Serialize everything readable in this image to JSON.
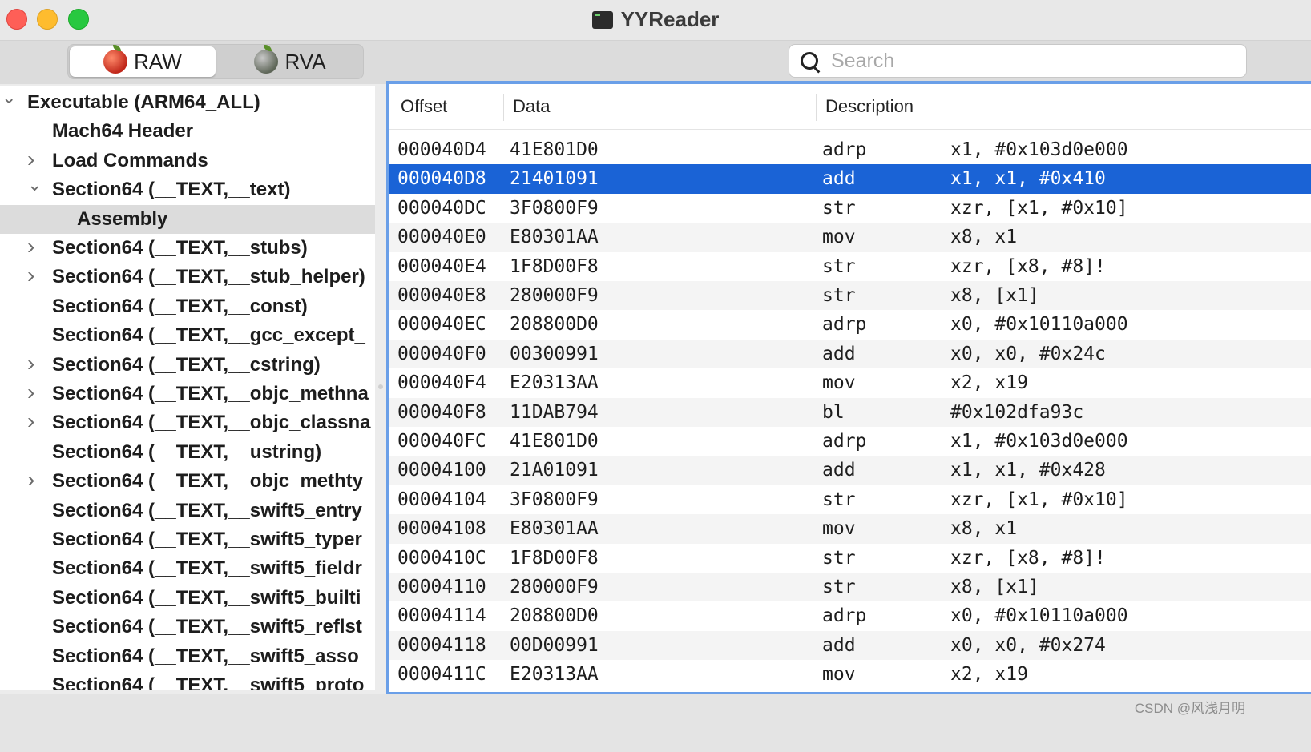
{
  "window": {
    "title": "YYReader"
  },
  "toolbar": {
    "segments": [
      {
        "label": "RAW",
        "icon": "apple-red-icon",
        "active": true
      },
      {
        "label": "RVA",
        "icon": "apple-gray-icon",
        "active": false
      }
    ],
    "search": {
      "placeholder": "Search",
      "value": ""
    }
  },
  "sidebar": {
    "items": [
      {
        "label": "Executable  (ARM64_ALL)",
        "indent": 0,
        "disclosure": "expanded"
      },
      {
        "label": "Mach64 Header",
        "indent": 1,
        "disclosure": "none"
      },
      {
        "label": "Load Commands",
        "indent": 1,
        "disclosure": "collapsed"
      },
      {
        "label": "Section64 (__TEXT,__text)",
        "indent": 1,
        "disclosure": "expanded"
      },
      {
        "label": "Assembly",
        "indent": 2,
        "disclosure": "none",
        "selected": true
      },
      {
        "label": "Section64 (__TEXT,__stubs)",
        "indent": 1,
        "disclosure": "collapsed"
      },
      {
        "label": "Section64 (__TEXT,__stub_helper)",
        "indent": 1,
        "disclosure": "collapsed"
      },
      {
        "label": "Section64 (__TEXT,__const)",
        "indent": 1,
        "disclosure": "none"
      },
      {
        "label": "Section64 (__TEXT,__gcc_except_",
        "indent": 1,
        "disclosure": "none"
      },
      {
        "label": "Section64 (__TEXT,__cstring)",
        "indent": 1,
        "disclosure": "collapsed"
      },
      {
        "label": "Section64 (__TEXT,__objc_methna",
        "indent": 1,
        "disclosure": "collapsed"
      },
      {
        "label": "Section64 (__TEXT,__objc_classna",
        "indent": 1,
        "disclosure": "collapsed"
      },
      {
        "label": "Section64 (__TEXT,__ustring)",
        "indent": 1,
        "disclosure": "none"
      },
      {
        "label": "Section64 (__TEXT,__objc_methty",
        "indent": 1,
        "disclosure": "collapsed"
      },
      {
        "label": "Section64 (__TEXT,__swift5_entry",
        "indent": 1,
        "disclosure": "none"
      },
      {
        "label": "Section64 (__TEXT,__swift5_typer",
        "indent": 1,
        "disclosure": "none"
      },
      {
        "label": "Section64 (__TEXT,__swift5_fieldr",
        "indent": 1,
        "disclosure": "none"
      },
      {
        "label": "Section64 (__TEXT,__swift5_builti",
        "indent": 1,
        "disclosure": "none"
      },
      {
        "label": "Section64 (__TEXT,__swift5_reflst",
        "indent": 1,
        "disclosure": "none"
      },
      {
        "label": "Section64 (__TEXT,__swift5_asso",
        "indent": 1,
        "disclosure": "none"
      },
      {
        "label": "Section64 (__TEXT,__swift5_proto",
        "indent": 1,
        "disclosure": "none"
      }
    ]
  },
  "table": {
    "headers": [
      "Offset",
      "Data",
      "Description"
    ],
    "selected_index": 1,
    "rows": [
      {
        "offset": "000040D4",
        "data": "41E801D0",
        "op": "adrp",
        "args": "x1, #0x103d0e000"
      },
      {
        "offset": "000040D8",
        "data": "21401091",
        "op": "add",
        "args": "x1, x1, #0x410"
      },
      {
        "offset": "000040DC",
        "data": "3F0800F9",
        "op": "str",
        "args": "xzr, [x1, #0x10]"
      },
      {
        "offset": "000040E0",
        "data": "E80301AA",
        "op": "mov",
        "args": "x8, x1"
      },
      {
        "offset": "000040E4",
        "data": "1F8D00F8",
        "op": "str",
        "args": "xzr, [x8, #8]!"
      },
      {
        "offset": "000040E8",
        "data": "280000F9",
        "op": "str",
        "args": "x8, [x1]"
      },
      {
        "offset": "000040EC",
        "data": "208800D0",
        "op": "adrp",
        "args": "x0, #0x10110a000"
      },
      {
        "offset": "000040F0",
        "data": "00300991",
        "op": "add",
        "args": "x0, x0, #0x24c"
      },
      {
        "offset": "000040F4",
        "data": "E20313AA",
        "op": "mov",
        "args": "x2, x19"
      },
      {
        "offset": "000040F8",
        "data": "11DAB794",
        "op": "bl",
        "args": "#0x102dfa93c"
      },
      {
        "offset": "000040FC",
        "data": "41E801D0",
        "op": "adrp",
        "args": "x1, #0x103d0e000"
      },
      {
        "offset": "00004100",
        "data": "21A01091",
        "op": "add",
        "args": "x1, x1, #0x428"
      },
      {
        "offset": "00004104",
        "data": "3F0800F9",
        "op": "str",
        "args": "xzr, [x1, #0x10]"
      },
      {
        "offset": "00004108",
        "data": "E80301AA",
        "op": "mov",
        "args": "x8, x1"
      },
      {
        "offset": "0000410C",
        "data": "1F8D00F8",
        "op": "str",
        "args": "xzr, [x8, #8]!"
      },
      {
        "offset": "00004110",
        "data": "280000F9",
        "op": "str",
        "args": "x8, [x1]"
      },
      {
        "offset": "00004114",
        "data": "208800D0",
        "op": "adrp",
        "args": "x0, #0x10110a000"
      },
      {
        "offset": "00004118",
        "data": "00D00991",
        "op": "add",
        "args": "x0, x0, #0x274"
      },
      {
        "offset": "0000411C",
        "data": "E20313AA",
        "op": "mov",
        "args": "x2, x19"
      }
    ]
  },
  "watermark": "CSDN @风浅月明",
  "colors": {
    "selection": "#1a63d6",
    "focus_ring": "#6a9fe8"
  }
}
